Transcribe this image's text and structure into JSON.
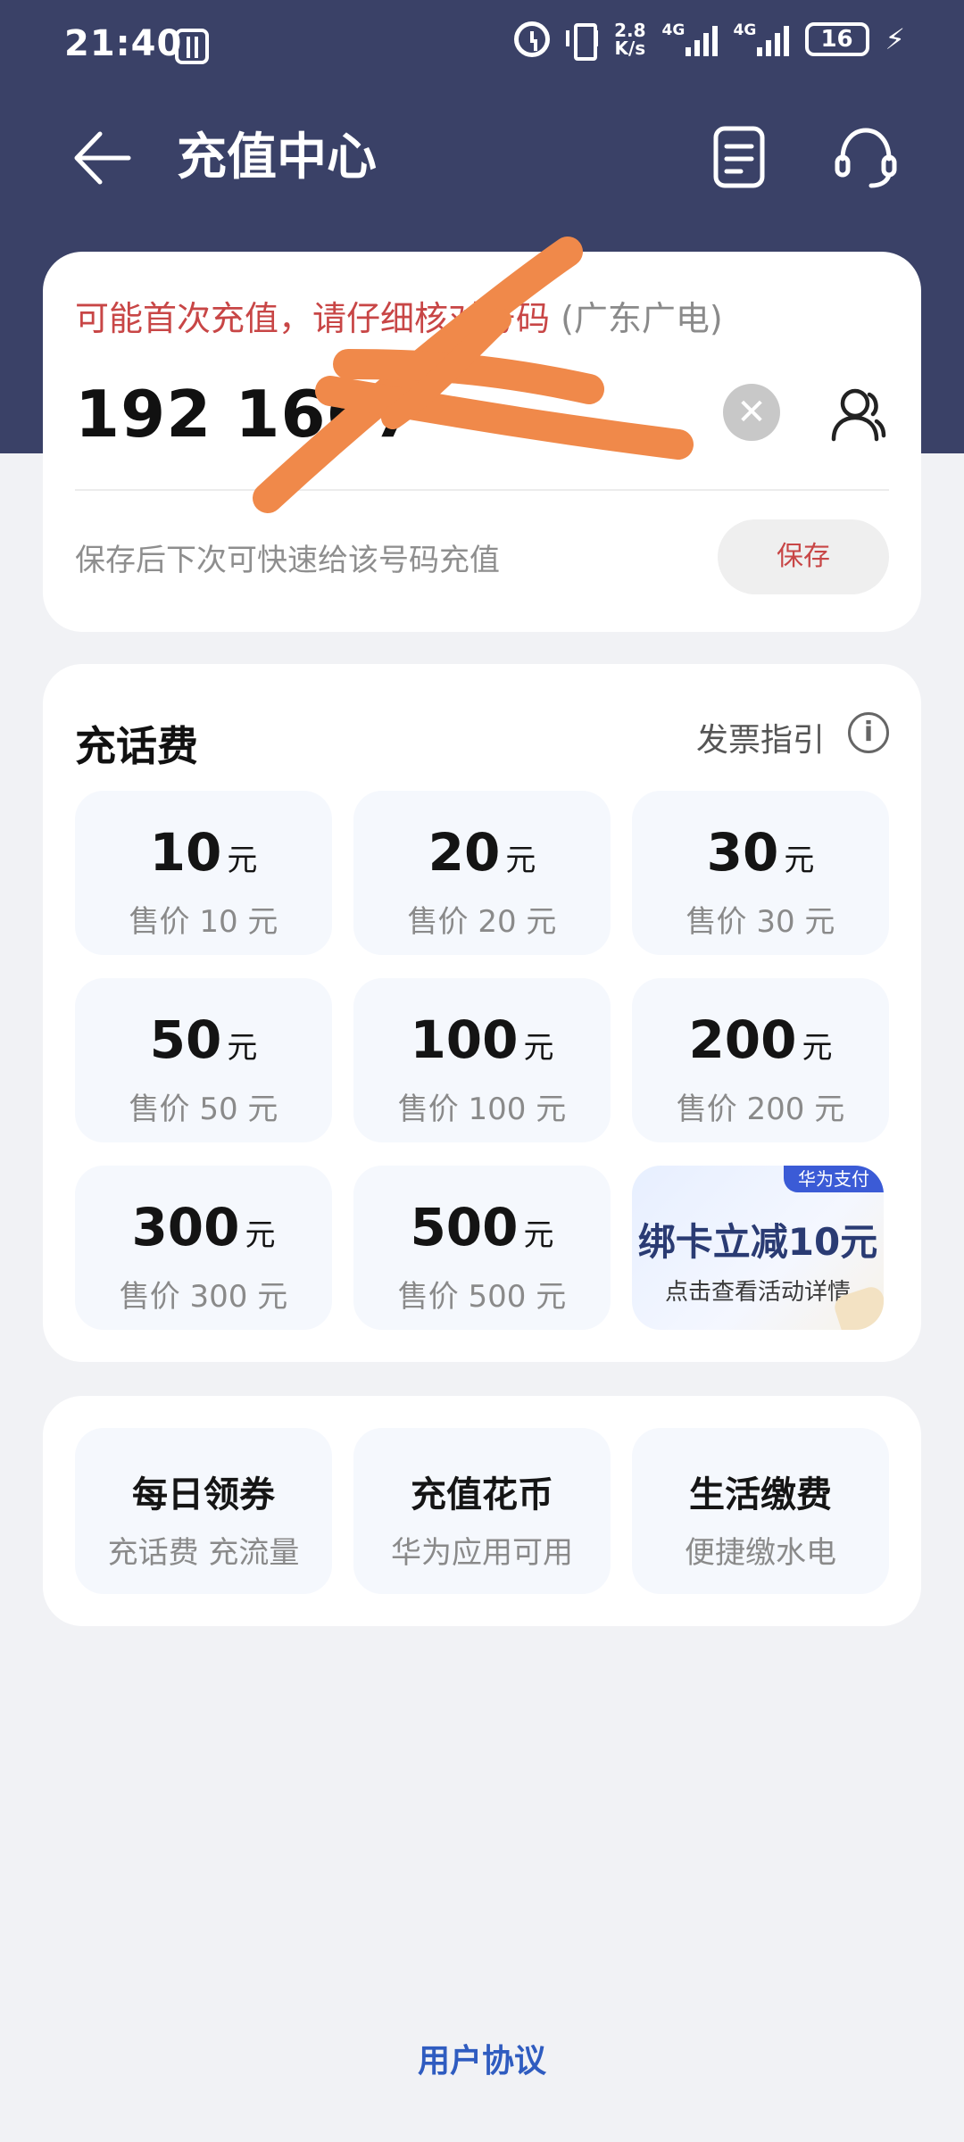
{
  "status_bar": {
    "time": "21:40",
    "net_speed_value": "2.8",
    "net_speed_unit": "K/s",
    "sim1_tag": "4G",
    "sim2_tag": "4G",
    "battery": "16"
  },
  "header": {
    "title": "充值中心"
  },
  "phone_card": {
    "warning": "可能首次充值，请仔细核对号码",
    "region": "(广东广电)",
    "phone_number": "192 1667",
    "clear_symbol": "✕",
    "save_hint": "保存后下次可快速给该号码充值",
    "save_label": "保存"
  },
  "recharge": {
    "title": "充话费",
    "invoice_label": "发票指引",
    "info_symbol": "i",
    "unit": "元",
    "tiles": [
      {
        "amount": "10",
        "price": "售价 10 元"
      },
      {
        "amount": "20",
        "price": "售价 20 元"
      },
      {
        "amount": "30",
        "price": "售价 30 元"
      },
      {
        "amount": "50",
        "price": "售价 50 元"
      },
      {
        "amount": "100",
        "price": "售价 100 元"
      },
      {
        "amount": "200",
        "price": "售价 200 元"
      },
      {
        "amount": "300",
        "price": "售价 300 元"
      },
      {
        "amount": "500",
        "price": "售价 500 元"
      }
    ],
    "promo": {
      "badge": "华为支付",
      "title": "绑卡立减10元",
      "subtitle": "点击查看活动详情"
    }
  },
  "services": [
    {
      "title": "每日领券",
      "subtitle": "充话费 充流量"
    },
    {
      "title": "充值花币",
      "subtitle": "华为应用可用"
    },
    {
      "title": "生活缴费",
      "subtitle": "便捷缴水电"
    }
  ],
  "footer": {
    "agreement": "用户协议"
  },
  "colors": {
    "header_bg": "#3a4167",
    "warning": "#c84646",
    "link": "#2f5cc0",
    "scribble": "#f0894a"
  }
}
